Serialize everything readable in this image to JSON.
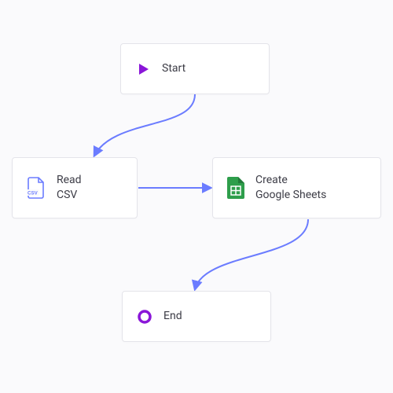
{
  "nodes": {
    "start": {
      "label": "Start"
    },
    "csv": {
      "label": "Read\nCSV"
    },
    "sheets": {
      "label": "Create\nGoogle Sheets"
    },
    "end": {
      "label": "End"
    }
  },
  "colors": {
    "connector": "#6b7cff",
    "accent_purple": "#8a16d8",
    "sheets_green": "#2e9e4b",
    "csv_outline": "#6b7cff"
  }
}
